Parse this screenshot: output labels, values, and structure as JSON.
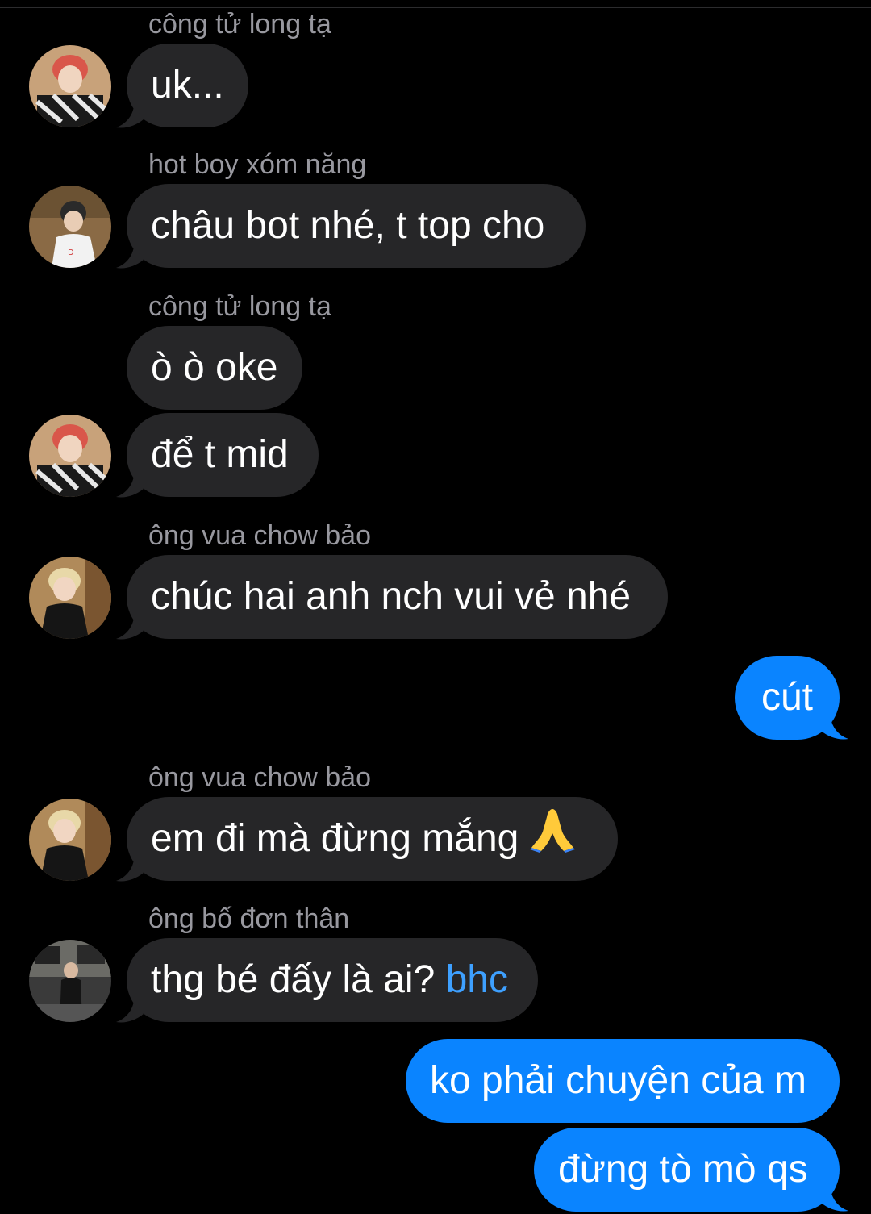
{
  "messages": [
    {
      "sender": "công tử long tạ",
      "text": "uk..."
    },
    {
      "sender": "hot boy xóm năng",
      "text": "châu bot nhé, t top cho"
    },
    {
      "sender": "công tử long tạ",
      "text": "ò ò oke"
    },
    {
      "text": "để t mid"
    },
    {
      "sender": "ông vua chow bảo",
      "text": "chúc hai anh nch vui vẻ nhé"
    },
    {
      "text": "cút"
    },
    {
      "sender": "ông vua chow bảo",
      "text": "em đi mà đừng mắng"
    },
    {
      "sender": "ông bố đơn thân",
      "text": "thg bé đấy là ai?",
      "mention": "bhc"
    },
    {
      "text": "ko phải chuyện của m"
    },
    {
      "text": "đừng tò mò qs"
    }
  ],
  "icons": {
    "pray": "folded-hands-emoji"
  },
  "colors": {
    "incoming_bubble": "#262628",
    "outgoing_bubble": "#0a84ff",
    "mention": "#3ea0ff",
    "sender_name": "#98989f"
  }
}
